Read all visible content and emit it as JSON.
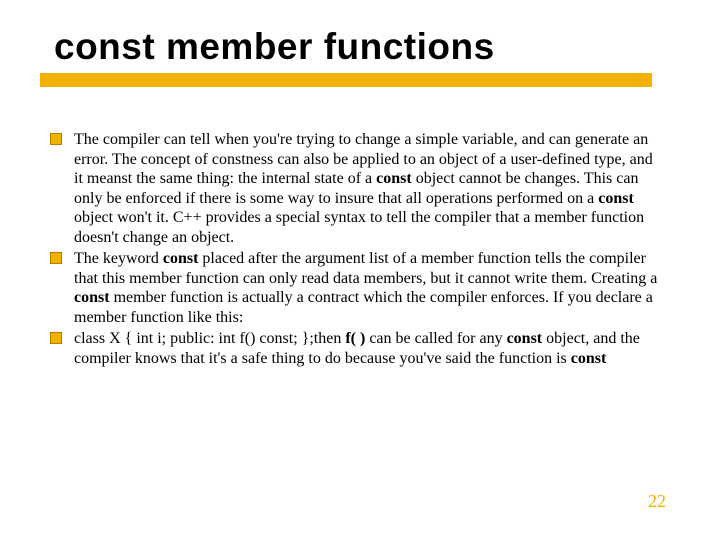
{
  "title": "const member functions",
  "bullets": [
    {
      "segments": [
        {
          "t": "The compiler can tell when you're trying to change a simple variable, and can generate an error. The concept of constness can also be applied to an object of a user-defined type, and it meanst the same thing: the internal state of a "
        },
        {
          "t": "const",
          "b": true
        },
        {
          "t": " object cannot be changes. This can only be enforced if there is some way to insure that all operations performed on a "
        },
        {
          "t": "const",
          "b": true
        },
        {
          "t": " object won't it. C++ provides a special syntax to tell the compiler that a member function doesn't change an object."
        }
      ]
    },
    {
      "segments": [
        {
          "t": "The keyword "
        },
        {
          "t": "const",
          "b": true
        },
        {
          "t": " placed after the argument list of a member function tells the compiler that this member function can only read data members, but it cannot write them. Creating a "
        },
        {
          "t": "const",
          "b": true
        },
        {
          "t": " member function is actually a contract which the compiler enforces. If you declare a member function like this:"
        }
      ]
    },
    {
      "segments": [
        {
          "t": "class X { int i; public: int f() const; };then "
        },
        {
          "t": "f( )",
          "b": true
        },
        {
          "t": " can be called for any "
        },
        {
          "t": "const",
          "b": true
        },
        {
          "t": " object, and the compiler knows that it's a safe thing to do because you've said the function is "
        },
        {
          "t": "const",
          "b": true
        }
      ]
    }
  ],
  "page_number": "22"
}
